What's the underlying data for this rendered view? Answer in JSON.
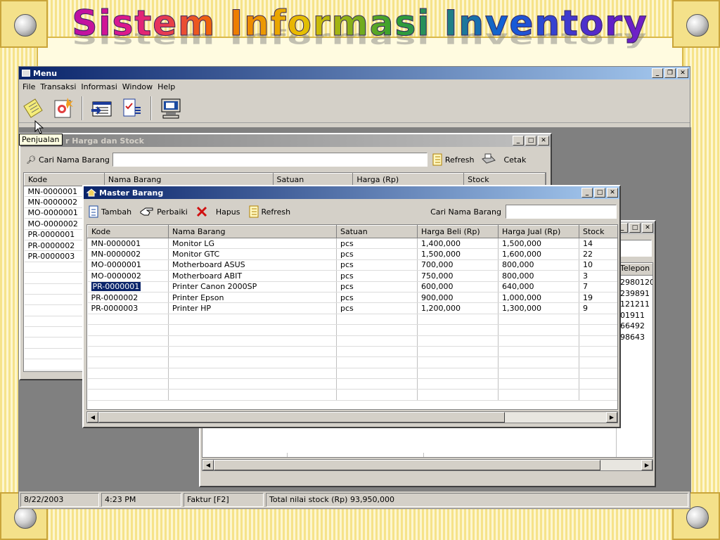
{
  "slide": {
    "title": "Sistem Informasi Inventory"
  },
  "app": {
    "title": "Menu",
    "menu": [
      "File",
      "Transaksi",
      "Informasi",
      "Window",
      "Help"
    ],
    "tooltip": "Penjualan",
    "toolbar_icons": [
      "sales-invoice-icon",
      "purchase-icon",
      "report-icon",
      "document-edit-icon",
      "computer-icon"
    ],
    "status": {
      "date": "8/22/2003",
      "time": "4:23 PM",
      "hint": "Faktur [F2]",
      "total": "Total nilai stock (Rp) 93,950,000"
    }
  },
  "daftar_window": {
    "title": "r Harga dan Stock",
    "search_label": "Cari Nama Barang",
    "search_value": "",
    "refresh_label": "Refresh",
    "print_label": "Cetak",
    "columns": [
      "Kode",
      "Nama Barang",
      "Satuan",
      "Harga (Rp)",
      "Stock"
    ],
    "codes": [
      "MN-0000001",
      "MN-0000002",
      "MO-0000001",
      "MO-0000002",
      "PR-0000001",
      "PR-0000002",
      "PR-0000003"
    ]
  },
  "back_window": {
    "column_partial": "Telepon",
    "values_partial": [
      "2980120",
      "239891",
      "121211",
      "01911",
      "66492",
      "98643"
    ]
  },
  "master_window": {
    "title": "Master Barang",
    "add_label": "Tambah",
    "edit_label": "Perbaiki",
    "delete_label": "Hapus",
    "refresh_label": "Refresh",
    "search_label": "Cari Nama Barang",
    "search_value": "",
    "columns": [
      "Kode",
      "Nama Barang",
      "Satuan",
      "Harga Beli (Rp)",
      "Harga Jual (Rp)",
      "Stock"
    ],
    "rows": [
      [
        "MN-0000001",
        "Monitor LG",
        "pcs",
        "1,400,000",
        "1,500,000",
        "14"
      ],
      [
        "MN-0000002",
        "Monitor GTC",
        "pcs",
        "1,500,000",
        "1,600,000",
        "22"
      ],
      [
        "MO-0000001",
        "Motherboard ASUS",
        "pcs",
        "700,000",
        "800,000",
        "10"
      ],
      [
        "MO-0000002",
        "Motherboard ABIT",
        "pcs",
        "750,000",
        "800,000",
        "3"
      ],
      [
        "PR-0000001",
        "Printer Canon 2000SP",
        "pcs",
        "600,000",
        "640,000",
        "7"
      ],
      [
        "PR-0000002",
        "Printer Epson",
        "pcs",
        "900,000",
        "1,000,000",
        "19"
      ],
      [
        "PR-0000003",
        "Printer HP",
        "pcs",
        "1,200,000",
        "1,300,000",
        "9"
      ]
    ],
    "selected_row": 4
  }
}
